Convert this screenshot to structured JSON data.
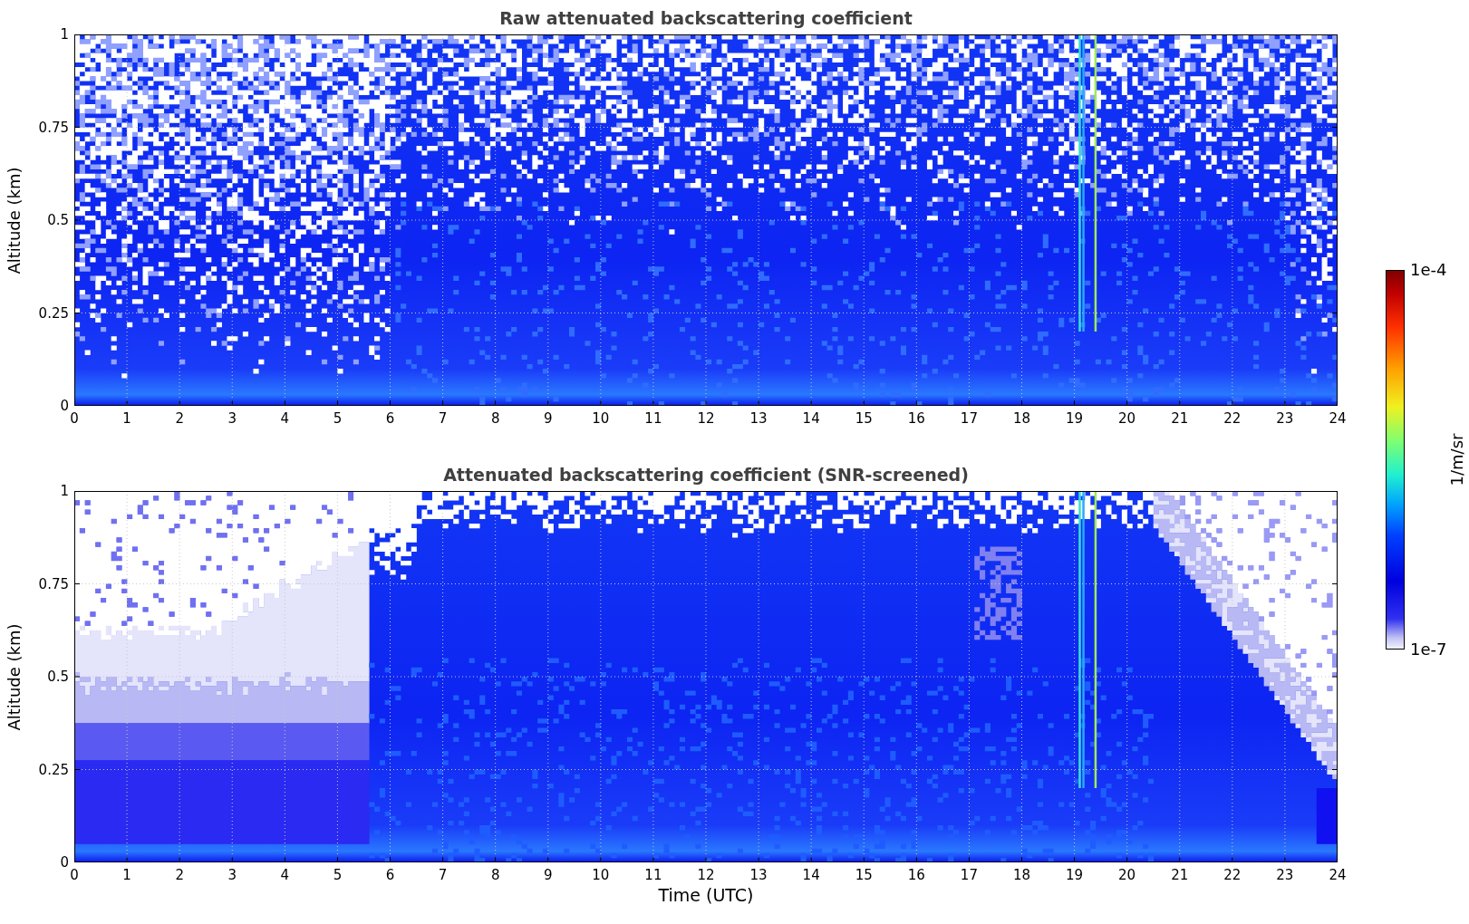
{
  "panels": [
    {
      "kind": "raw",
      "title": "Raw attenuated backscattering coefficient",
      "ylabel": "Altitude (km)",
      "yticks": [
        "1",
        "0.75",
        "0.5",
        "0.25",
        "0"
      ],
      "xticks": [
        "0",
        "1",
        "2",
        "3",
        "4",
        "5",
        "6",
        "7",
        "8",
        "9",
        "10",
        "11",
        "12",
        "13",
        "14",
        "15",
        "16",
        "17",
        "18",
        "19",
        "20",
        "21",
        "22",
        "23",
        "24"
      ]
    },
    {
      "kind": "screened",
      "title": "Attenuated backscattering coefficient (SNR-screened)",
      "ylabel": "Altitude (km)",
      "yticks": [
        "1",
        "0.75",
        "0.5",
        "0.25",
        "0"
      ],
      "xticks": [
        "0",
        "1",
        "2",
        "3",
        "4",
        "5",
        "6",
        "7",
        "8",
        "9",
        "10",
        "11",
        "12",
        "13",
        "14",
        "15",
        "16",
        "17",
        "18",
        "19",
        "20",
        "21",
        "22",
        "23",
        "24"
      ],
      "xlabel": "Time (UTC)"
    }
  ],
  "colorbar": {
    "max_label": "1e-4",
    "min_label": "1e-7",
    "label": "1/m/sr"
  }
}
